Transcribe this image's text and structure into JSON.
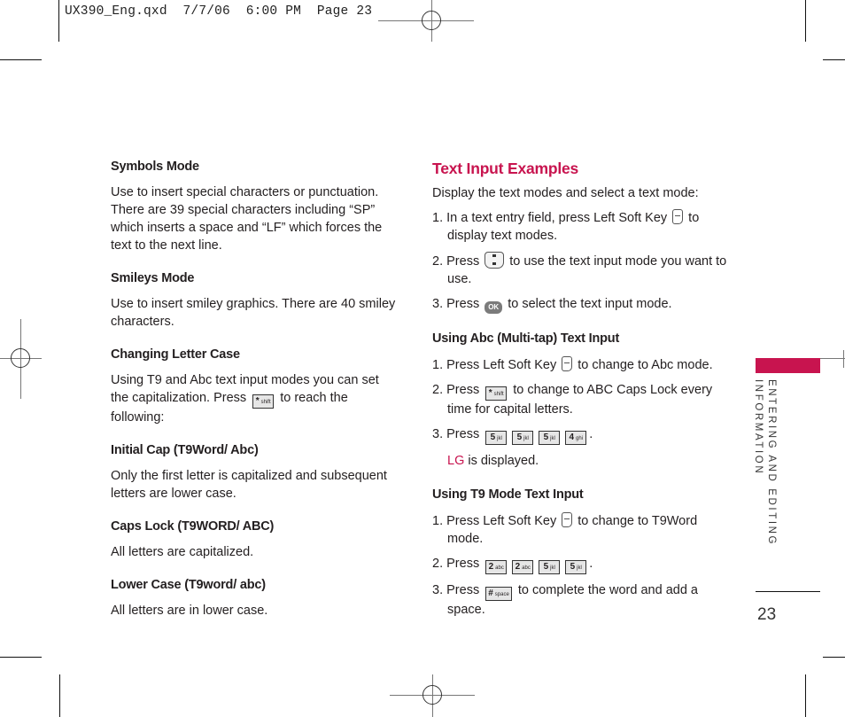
{
  "slug": "UX390_Eng.qxd  7/7/06  6:00 PM  Page 23",
  "left_column": {
    "sections": [
      {
        "heading": "Symbols Mode",
        "text": "Use to insert special characters or punctuation. There are 39 special characters including “SP” which inserts a space and “LF” which forces the text to the next line."
      },
      {
        "heading": "Smileys Mode",
        "text": "Use to insert smiley graphics. There are 40 smiley characters."
      },
      {
        "heading": "Changing Letter Case",
        "text_before_key": "Using T9 and Abc text input modes you can set the capitalization. Press",
        "key": "*",
        "key_sub": "shift",
        "text_after_key": "to reach the following:"
      },
      {
        "heading": "Initial Cap (T9Word/ Abc)",
        "text": "Only the first letter is capitalized and subsequent letters are lower case."
      },
      {
        "heading": "Caps Lock (T9WORD/ ABC)",
        "text": "All letters are capitalized."
      },
      {
        "heading": "Lower Case (T9word/ abc)",
        "text": "All letters are in lower case."
      }
    ]
  },
  "right_column": {
    "title": "Text Input Examples",
    "intro": "Display the text modes and select a text mode:",
    "steps": [
      {
        "num": "1.",
        "before": "In a text entry field, press Left Soft Key",
        "after": "to display text modes."
      },
      {
        "num": "2.",
        "before": "Press",
        "after": "to use the text input mode you want to use."
      },
      {
        "num": "3.",
        "before": "Press",
        "key": "OK",
        "after": "to select the text input mode."
      }
    ],
    "abc_section": {
      "heading": "Using Abc (Multi-tap) Text Input",
      "steps": [
        {
          "num": "1.",
          "before": "Press Left Soft Key",
          "after": "to change to Abc mode."
        },
        {
          "num": "2.",
          "before": "Press",
          "key": "*",
          "key_sub": "shift",
          "after": "to change to ABC Caps Lock every time for capital letters."
        },
        {
          "num": "3.",
          "before": "Press",
          "keys": [
            {
              "d": "5",
              "l": "jkl"
            },
            {
              "d": "5",
              "l": "jkl"
            },
            {
              "d": "5",
              "l": "jkl"
            },
            {
              "d": "4",
              "l": "ghi"
            }
          ],
          "after": "."
        }
      ],
      "result_highlight": "LG",
      "result_text": " is displayed."
    },
    "t9_section": {
      "heading": "Using T9 Mode Text Input",
      "steps": [
        {
          "num": "1.",
          "before": "Press Left Soft Key",
          "after": "to change to T9Word mode."
        },
        {
          "num": "2.",
          "before": "Press",
          "keys": [
            {
              "d": "2",
              "l": "abc"
            },
            {
              "d": "2",
              "l": "abc"
            },
            {
              "d": "5",
              "l": "jkl"
            },
            {
              "d": "5",
              "l": "jkl"
            }
          ],
          "after": "."
        },
        {
          "num": "3.",
          "before": "Press",
          "key": "#",
          "key_sub": "space",
          "after": "to complete the word and add a space."
        }
      ]
    }
  },
  "side_tab": {
    "line1": "ENTERING AND EDITING",
    "line2": "INFORMATION",
    "color": "#c8144f"
  },
  "page_number": "23",
  "accent_color": "#c8144f"
}
